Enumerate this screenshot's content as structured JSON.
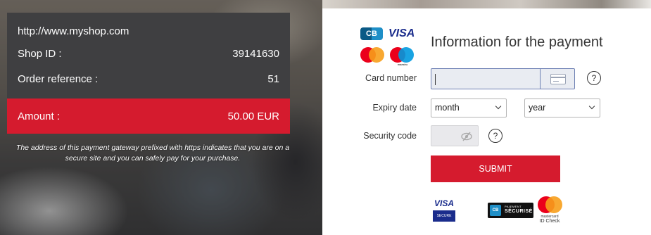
{
  "shop": {
    "url": "http://www.myshop.com",
    "shop_id_label": "Shop ID :",
    "shop_id_value": "39141630",
    "order_ref_label": "Order reference :",
    "order_ref_value": "51",
    "amount_label": "Amount :",
    "amount_value": "50.00 EUR"
  },
  "notice": "The address of this payment gateway prefixed with https indicates that you are on a secure site and you can safely pay for your purchase.",
  "logos_top": {
    "cb": "CB",
    "visa": "VISA",
    "maestro_text": "maestro"
  },
  "form": {
    "title": "Information for the payment",
    "card_number_label": "Card number",
    "card_number_value": "",
    "expiry_label": "Expiry date",
    "month_selected": "month",
    "year_selected": "year",
    "security_label": "Security code",
    "security_value": "",
    "help_glyph": "?",
    "submit_label": "SUBMIT"
  },
  "security_logos": {
    "visa_secure_top": "VISA",
    "visa_secure_bottom": "SECURE",
    "paiement_top": "PAIEMENT",
    "paiement_bottom": "SÉCURISÉ",
    "paiement_badge": "CB",
    "mc_brand": "mastercard",
    "mc_idcheck": "ID Check"
  },
  "colors": {
    "accent_red": "#d51b2e",
    "card_dark": "#3f3f41",
    "visa_blue": "#1a2c8c"
  }
}
